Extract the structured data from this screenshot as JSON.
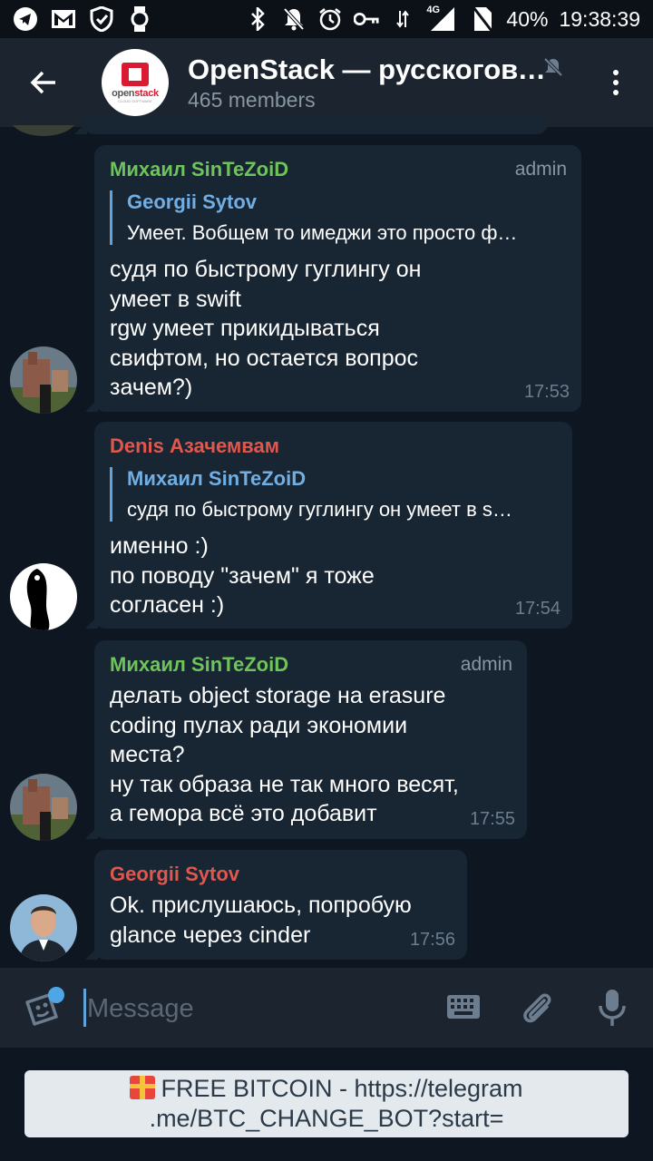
{
  "status_bar": {
    "battery": "40%",
    "time": "19:38:39",
    "network": "4G"
  },
  "header": {
    "title": "OpenStack — русскогово…",
    "members": "465 members",
    "avatar_logo_prefix": "open",
    "avatar_logo_suffix": "stack",
    "avatar_logo_sub": "CLOUD SOFTWARE"
  },
  "messages": [
    {
      "author": "Михаил SinTeZoiD",
      "role": "admin",
      "reply_author": "Georgii Sytov",
      "reply_text": "Умеет.  Вобщем то имеджи это просто ф…",
      "text": "судя по быстрому гуглингу он\nумеет в swift\nrgw умеет прикидываться\nсвифтом, но остается вопрос\nзачем?)",
      "time": "17:53"
    },
    {
      "author": "Denis Азачемвам",
      "reply_author": "Михаил SinTeZoiD",
      "reply_text": "судя по быстрому гуглингу он умеет в s…",
      "text": "именно :)\nпо поводу \"зачем\" я тоже\nсогласен :)",
      "time": "17:54"
    },
    {
      "author": "Михаил SinTeZoiD",
      "role": "admin",
      "text": "делать object storage на erasure\ncoding пулах ради экономии\nместа?\nну так образа не так много весят,\nа гемора всё это добавит",
      "time": "17:55"
    },
    {
      "author": "Georgii Sytov",
      "text": "Ok. прислушаюсь, попробую\nglance через cinder",
      "time": "17:56"
    }
  ],
  "composer": {
    "placeholder": "Message"
  },
  "bot_keyboard": {
    "button_label": "FREE BITCOIN - https://telegram\n.me/BTC_CHANGE_BOT?start="
  },
  "colors": {
    "background": "#0e1621",
    "header": "#1c242f",
    "bubble": "#182533",
    "admin_name": "#6ec45a",
    "user_name": "#e0574d",
    "reply_name": "#71aee3",
    "accent": "#5fa5db"
  }
}
